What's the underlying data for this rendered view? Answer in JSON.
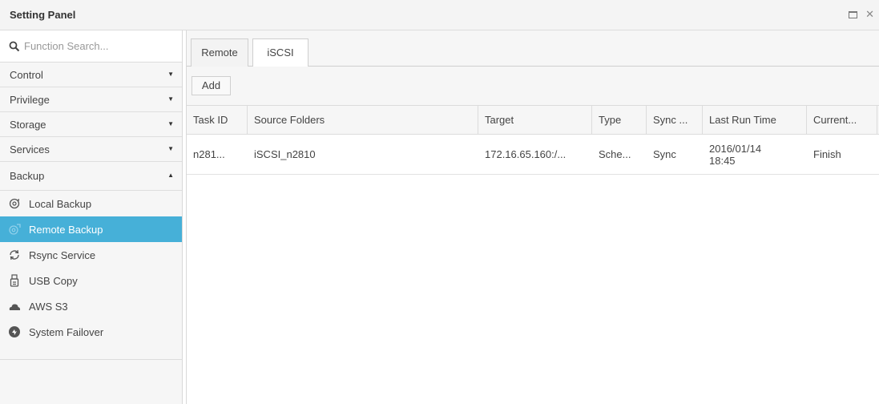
{
  "window": {
    "title": "Setting Panel"
  },
  "sidebar": {
    "search_placeholder": "Function Search...",
    "categories": [
      {
        "label": "Control",
        "arrow": "▼"
      },
      {
        "label": "Privilege",
        "arrow": "▼"
      },
      {
        "label": "Storage",
        "arrow": "▼"
      },
      {
        "label": "Services",
        "arrow": "▼"
      },
      {
        "label": "Backup",
        "arrow": "▲"
      }
    ],
    "backup_items": [
      {
        "label": "Local Backup",
        "icon": "local-backup-icon"
      },
      {
        "label": "Remote Backup",
        "icon": "remote-backup-icon",
        "active": true
      },
      {
        "label": "Rsync Service",
        "icon": "rsync-icon"
      },
      {
        "label": "USB Copy",
        "icon": "usb-icon"
      },
      {
        "label": "AWS S3",
        "icon": "cloud-icon"
      },
      {
        "label": "System Failover",
        "icon": "failover-icon"
      }
    ]
  },
  "main": {
    "tabs": [
      {
        "label": "Remote"
      },
      {
        "label": "iSCSI",
        "active": true
      }
    ],
    "add_label": "Add",
    "columns": [
      "Task ID",
      "Source Folders",
      "Target",
      "Type",
      "Sync ...",
      "Last Run Time",
      "Current..."
    ],
    "rows": [
      [
        "n281...",
        "iSCSI_n2810",
        "172.16.65.160:/...",
        "Sche...",
        "Sync",
        "2016/01/14 18:45",
        "Finish"
      ]
    ]
  },
  "colors": {
    "accent": "#46b0d8"
  }
}
